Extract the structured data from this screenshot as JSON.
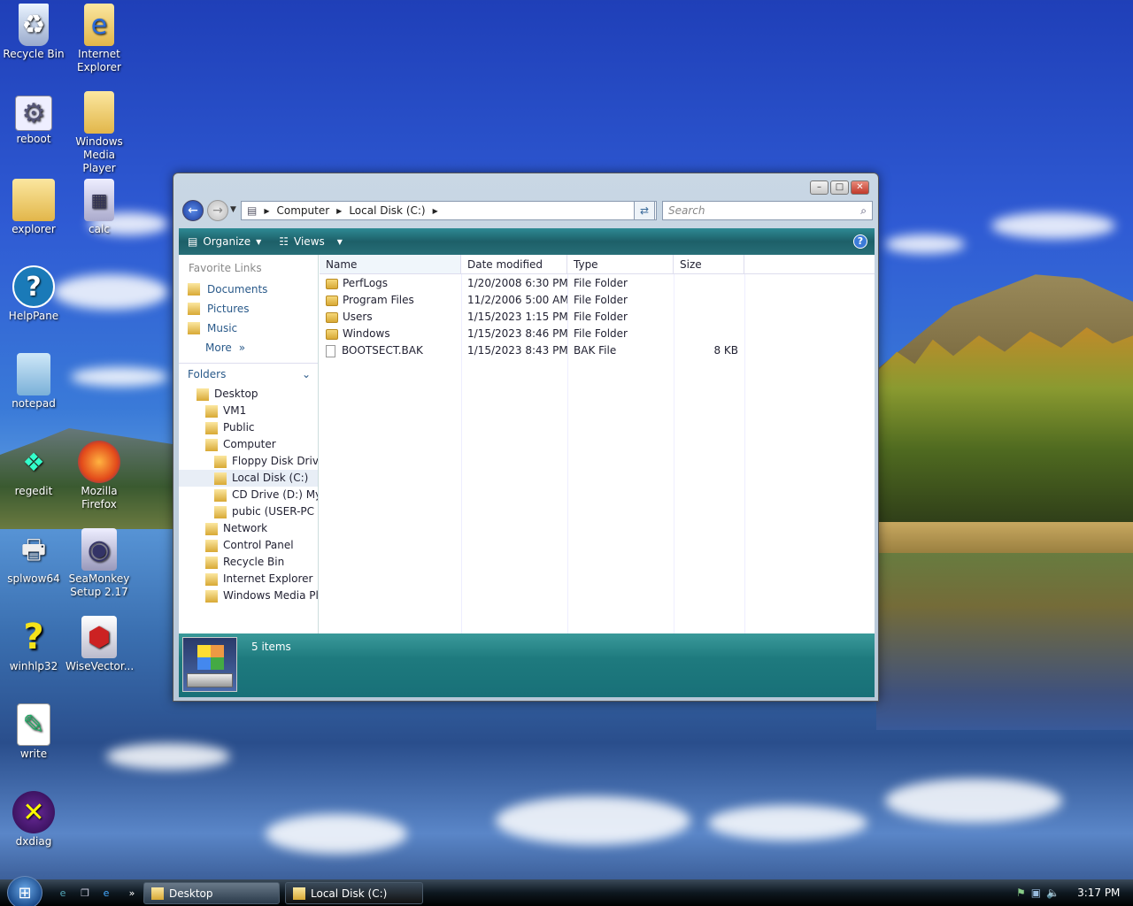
{
  "desktop": {
    "icons": [
      {
        "label_l1": "Recycle Bin",
        "label_l2": "",
        "icon": "recycle-bin-icon"
      },
      {
        "label_l1": "Internet",
        "label_l2": "Explorer",
        "icon": "internet-explorer-icon"
      },
      {
        "label_l1": "reboot",
        "label_l2": "",
        "icon": "reboot-icon"
      },
      {
        "label_l1": "Windows",
        "label_l2": "Media Player",
        "icon": "folder-icon"
      },
      {
        "label_l1": "explorer",
        "label_l2": "",
        "icon": "explorer-folder-icon"
      },
      {
        "label_l1": "calc",
        "label_l2": "",
        "icon": "calculator-icon"
      },
      {
        "label_l1": "HelpPane",
        "label_l2": "",
        "icon": "help-icon"
      },
      {
        "label_l1": "notepad",
        "label_l2": "",
        "icon": "notepad-icon"
      },
      {
        "label_l1": "regedit",
        "label_l2": "",
        "icon": "regedit-icon"
      },
      {
        "label_l1": "Mozilla",
        "label_l2": "Firefox",
        "icon": "firefox-icon"
      },
      {
        "label_l1": "splwow64",
        "label_l2": "",
        "icon": "printer-icon"
      },
      {
        "label_l1": "SeaMonkey",
        "label_l2": "Setup 2.17",
        "icon": "installer-icon"
      },
      {
        "label_l1": "winhlp32",
        "label_l2": "",
        "icon": "question-mark-icon"
      },
      {
        "label_l1": "WiseVector...",
        "label_l2": "",
        "icon": "wisevector-icon"
      },
      {
        "label_l1": "write",
        "label_l2": "",
        "icon": "wordpad-icon"
      },
      {
        "label_l1": "dxdiag",
        "label_l2": "",
        "icon": "dxdiag-icon"
      }
    ]
  },
  "window": {
    "address": {
      "root": "Computer",
      "current": "Local Disk (C:)"
    },
    "search_placeholder": "Search",
    "toolbar": {
      "organize": "Organize",
      "views": "Views"
    },
    "nav": {
      "favorite_links_title": "Favorite Links",
      "favorites": [
        "Documents",
        "Pictures",
        "Music"
      ],
      "more": "More",
      "folders_title": "Folders",
      "tree": [
        {
          "label": "Desktop",
          "level": 0
        },
        {
          "label": "VM1",
          "level": 1
        },
        {
          "label": "Public",
          "level": 1
        },
        {
          "label": "Computer",
          "level": 1
        },
        {
          "label": "Floppy Disk Drive",
          "level": 2
        },
        {
          "label": "Local Disk (C:)",
          "level": 2,
          "selected": true
        },
        {
          "label": "CD Drive (D:) MyP",
          "level": 2
        },
        {
          "label": "pubic (USER-PC (t",
          "level": 2
        },
        {
          "label": "Network",
          "level": 1
        },
        {
          "label": "Control Panel",
          "level": 1
        },
        {
          "label": "Recycle Bin",
          "level": 1
        },
        {
          "label": "Internet Explorer",
          "level": 1
        },
        {
          "label": "Windows Media Pla",
          "level": 1
        }
      ]
    },
    "columns": {
      "name": "Name",
      "date": "Date modified",
      "type": "Type",
      "size": "Size"
    },
    "files": [
      {
        "name": "PerfLogs",
        "date": "1/20/2008 6:30 PM",
        "type": "File Folder",
        "size": "",
        "kind": "folder"
      },
      {
        "name": "Program Files",
        "date": "11/2/2006 5:00 AM",
        "type": "File Folder",
        "size": "",
        "kind": "folder"
      },
      {
        "name": "Users",
        "date": "1/15/2023 1:15 PM",
        "type": "File Folder",
        "size": "",
        "kind": "folder"
      },
      {
        "name": "Windows",
        "date": "1/15/2023 8:46 PM",
        "type": "File Folder",
        "size": "",
        "kind": "folder"
      },
      {
        "name": "BOOTSECT.BAK",
        "date": "1/15/2023 8:43 PM",
        "type": "BAK File",
        "size": "8 KB",
        "kind": "file"
      }
    ],
    "status": "5 items"
  },
  "taskbar": {
    "tasks": [
      "Desktop",
      "Local Disk (C:)"
    ],
    "clock": "3:17 PM"
  }
}
